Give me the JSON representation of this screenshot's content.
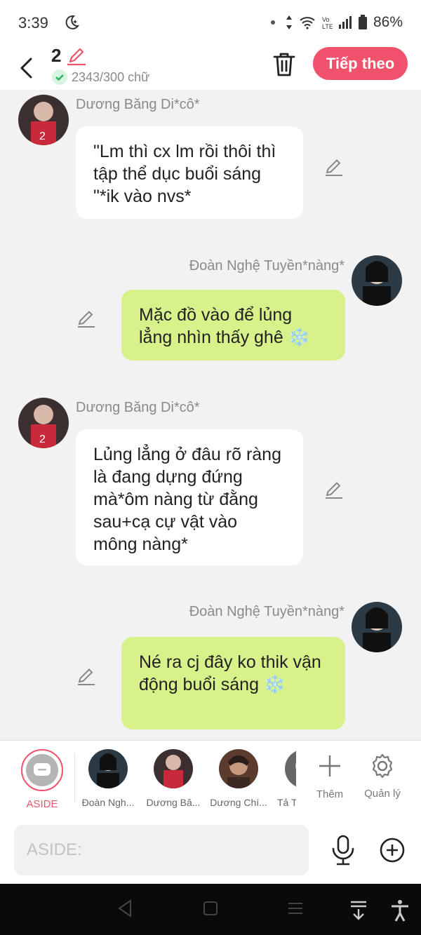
{
  "status_bar": {
    "time": "3:39",
    "battery": "86%"
  },
  "header": {
    "count": "2",
    "word_count": "2343/300 chữ",
    "next_label": "Tiếp theo"
  },
  "messages": [
    {
      "side": "left",
      "name": "Dương Băng Di*cô*",
      "text": "\"Lm thì cx lm rồi thôi thì tập thể dục buổi sáng \"*ik vào nvs*"
    },
    {
      "side": "right",
      "name": "Đoàn Nghệ Tuyền*nàng*",
      "text": "Mặc đồ vào để lủng lẳng nhìn thấy ghê ❄️"
    },
    {
      "side": "left",
      "name": "Dương Băng Di*cô*",
      "text": "Lủng lẳng ở đâu rõ ràng là đang dựng đứng mà*ôm nàng từ đằng sau+cạ cự vật vào mông nàng*"
    },
    {
      "side": "right",
      "name": "Đoàn Nghệ Tuyền*nàng*",
      "text": "Né ra cj đây ko thik vận động buổi sáng ❄️"
    }
  ],
  "character_bar": {
    "aside_label": "ASIDE",
    "characters": [
      "Đoàn Ngh...",
      "Dương Bă...",
      "Dương Chí...",
      "Tả T"
    ],
    "add_label": "Thêm",
    "manage_label": "Quản lý"
  },
  "input": {
    "placeholder": "ASIDE:"
  },
  "colors": {
    "accent": "#f1526b",
    "bubble_right": "#d7f28a",
    "bubble_left": "#ffffff",
    "background": "#f2f2f3"
  }
}
